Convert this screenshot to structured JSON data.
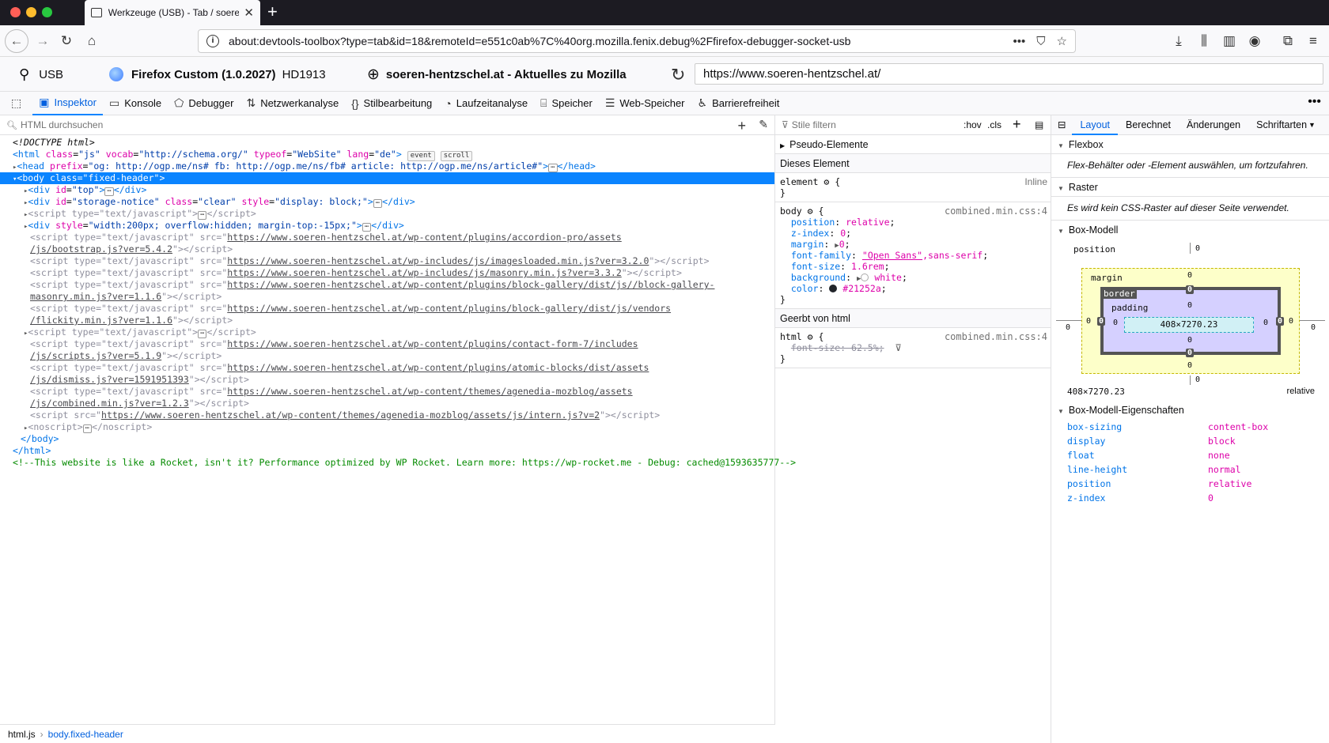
{
  "browser": {
    "tab_title": "Werkzeuge (USB) - Tab / soeren",
    "url": "about:devtools-toolbox?type=tab&id=18&remoteId=e551c0ab%7C%40org.mozilla.fenix.debug%2Ffirefox-debugger-socket-usb"
  },
  "target": {
    "connection": "USB",
    "runtime_name": "Firefox Custom (1.0.2027)",
    "device": "HD1913",
    "page_title": "soeren-hentzschel.at - Aktuelles zu Mozilla",
    "page_url": "https://www.soeren-hentzschel.at/"
  },
  "devtools_tabs": [
    {
      "label": "Inspektor",
      "icon": "inspector-icon"
    },
    {
      "label": "Konsole",
      "icon": "console-icon"
    },
    {
      "label": "Debugger",
      "icon": "debugger-icon"
    },
    {
      "label": "Netzwerkanalyse",
      "icon": "network-icon"
    },
    {
      "label": "Stilbearbeitung",
      "icon": "style-editor-icon"
    },
    {
      "label": "Laufzeitanalyse",
      "icon": "performance-icon"
    },
    {
      "label": "Speicher",
      "icon": "memory-icon"
    },
    {
      "label": "Web-Speicher",
      "icon": "storage-icon"
    },
    {
      "label": "Barrierefreiheit",
      "icon": "accessibility-icon"
    }
  ],
  "markup": {
    "search_placeholder": "HTML durchsuchen",
    "comment": "<!--This website is like a Rocket, isn't it? Performance optimized by WP Rocket. Learn more: https://wp-rocket.me - Debug: cached@1593635777-->"
  },
  "breadcrumbs": [
    "html.js",
    "body.fixed-header"
  ],
  "rules": {
    "filter_placeholder": "Stile filtern",
    "hov": ":hov",
    "cls": ".cls",
    "pseudo_elements": "Pseudo-Elemente",
    "this_element": "Dieses Element",
    "inline": "Inline",
    "inherited_from": "Geerbt von html",
    "source": "combined.min.css:4"
  },
  "layout": {
    "tabs": [
      "Layout",
      "Berechnet",
      "Änderungen",
      "Schriftarten"
    ],
    "flexbox_title": "Flexbox",
    "flexbox_msg": "Flex-Behälter oder -Element auswählen, um fortzufahren.",
    "grid_title": "Raster",
    "grid_msg": "Es wird kein CSS-Raster auf dieser Seite verwendet.",
    "boxmodel_title": "Box-Modell",
    "boxmodel": {
      "position_label": "position",
      "margin_label": "margin",
      "border_label": "border",
      "padding_label": "padding",
      "content_size": "408×7270.23",
      "zero": "0"
    },
    "size_readout": "408×7270.23",
    "position_readout": "relative",
    "props_title": "Box-Modell-Eigenschaften",
    "props": [
      {
        "k": "box-sizing",
        "v": "content-box"
      },
      {
        "k": "display",
        "v": "block"
      },
      {
        "k": "float",
        "v": "none"
      },
      {
        "k": "line-height",
        "v": "normal"
      },
      {
        "k": "position",
        "v": "relative"
      },
      {
        "k": "z-index",
        "v": "0"
      }
    ]
  }
}
